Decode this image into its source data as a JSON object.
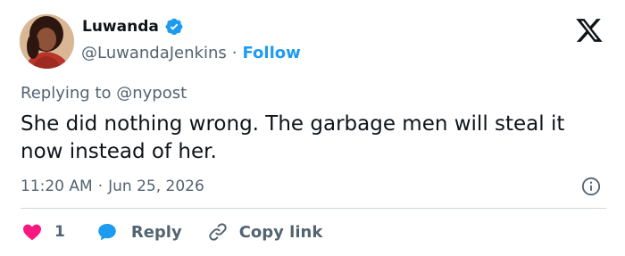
{
  "author": {
    "name": "Luwanda",
    "handle": "@LuwandaJenkins",
    "separator": "·",
    "follow_label": "Follow"
  },
  "tweet": {
    "replying_prefix": "Replying to",
    "replying_to": "@nypost",
    "text": "She did nothing wrong. The garbage men will steal it now instead of her.",
    "time": "11:20 AM",
    "meta_separator": "·",
    "date": "Jun 25, 2026"
  },
  "actions": {
    "like_count": "1",
    "reply_label": "Reply",
    "copy_link_label": "Copy link"
  },
  "icons": {
    "verified": "verified-badge-icon",
    "logo": "x-logo-icon",
    "info": "info-icon",
    "like": "heart-icon",
    "reply": "speech-bubble-icon",
    "copy": "link-icon"
  },
  "colors": {
    "accent": "#1d9bf0",
    "like": "#f91880",
    "text": "#0f1419",
    "muted": "#536471",
    "divider": "#cfd9de"
  }
}
